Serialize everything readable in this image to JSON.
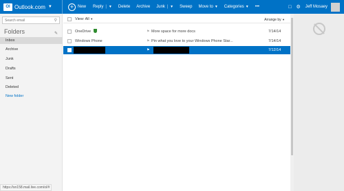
{
  "brand": {
    "logo": "Ol",
    "name": "Outlook.com"
  },
  "toolbar": {
    "new": "New",
    "reply": "Reply",
    "delete": "Delete",
    "archive": "Archive",
    "junk": "Junk",
    "sweep": "Sweep",
    "move_to": "Move to",
    "categories": "Categories",
    "more": "•••"
  },
  "user": {
    "name": "Jeff Mosaey"
  },
  "sidebar": {
    "search_placeholder": "Search email",
    "folders_title": "Folders",
    "folders": [
      {
        "label": "Inbox"
      },
      {
        "label": "Archive"
      },
      {
        "label": "Junk"
      },
      {
        "label": "Drafts"
      },
      {
        "label": "Sent"
      },
      {
        "label": "Deleted"
      }
    ],
    "new_folder": "New folder"
  },
  "list": {
    "view_all": "View: All",
    "arrange_by": "Arrange by",
    "messages": [
      {
        "from": "OneDrive",
        "subject": "More space for more docs",
        "date": "7/14/14",
        "selected": false
      },
      {
        "from": "Windows Phone",
        "subject": "Pin what you love to your Windows Phone Star...",
        "date": "7/14/14",
        "selected": false
      },
      {
        "from": "",
        "subject": "",
        "date": "7/12/14",
        "selected": true
      }
    ]
  },
  "status_url": "https://sn158.mail.live.com/ol/#",
  "colors": {
    "accent": "#0072c6",
    "sidebar_bg": "#f3f3f3",
    "reading_bg": "#ececec"
  },
  "icons": [
    "outlook-logo-icon",
    "new-plus-icon",
    "chevron-down-icon",
    "chat-icon",
    "gear-icon",
    "search-icon",
    "edit-icon",
    "shield-icon",
    "flag-icon",
    "no-message-icon"
  ]
}
